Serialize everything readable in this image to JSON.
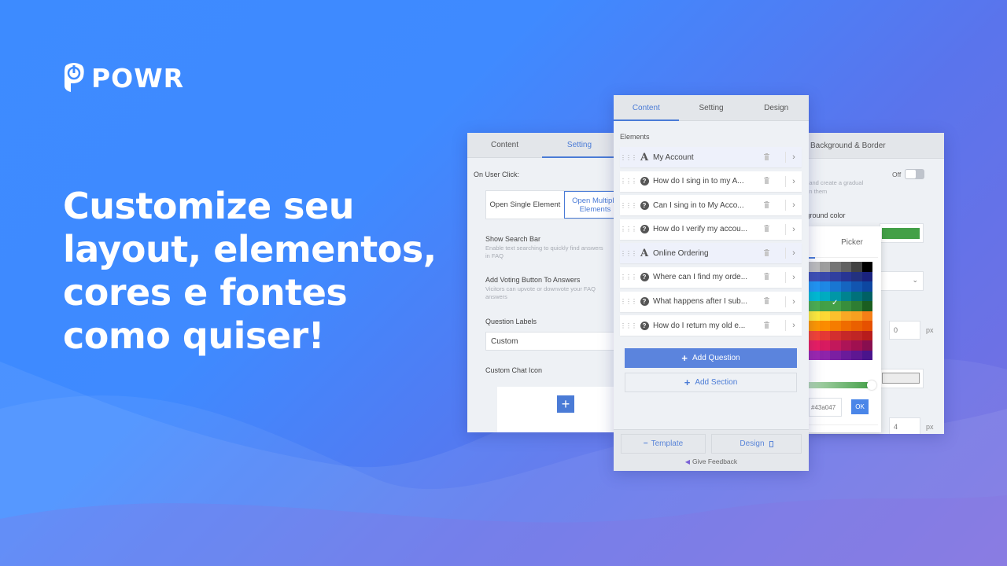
{
  "brand": {
    "name": "POWR"
  },
  "headline": {
    "lines": [
      "Customize seu",
      "layout, elementos,",
      "cores e fontes",
      "como quiser!"
    ]
  },
  "left_panel": {
    "tabs": [
      {
        "label": "Content",
        "active": false
      },
      {
        "label": "Setting",
        "active": true
      }
    ],
    "on_user_click_label": "On User Click:",
    "segmented": [
      {
        "label": "Open Single Element",
        "active": false
      },
      {
        "label": "Open Multiple Elements",
        "active": true
      }
    ],
    "show_search_bar": {
      "label": "Show Search Bar",
      "description": "Enable text searching to quickly find answers in FAQ"
    },
    "voting_button": {
      "label": "Add Voting Button To Answers",
      "description": "Vicitors can upvote or downvote your FAQ answers"
    },
    "question_labels": {
      "label": "Question Labels",
      "value": "Custom"
    },
    "custom_chat_icon": {
      "label": "Custom Chat Icon",
      "add_icon": "+"
    }
  },
  "center_panel": {
    "tabs": [
      {
        "label": "Content",
        "active": true
      },
      {
        "label": "Setting",
        "active": false
      },
      {
        "label": "Design",
        "active": false
      }
    ],
    "elements_label": "Elements",
    "elements": [
      {
        "type": "section",
        "label": "My Account"
      },
      {
        "type": "question",
        "label": "How do I sing in to my A..."
      },
      {
        "type": "question",
        "label": "Can I sing in to My Acco..."
      },
      {
        "type": "question",
        "label": "How do I verify my accou..."
      },
      {
        "type": "section",
        "label": "Online Ordering"
      },
      {
        "type": "question",
        "label": "Where can I find my orde..."
      },
      {
        "type": "question",
        "label": "What happens after I sub..."
      },
      {
        "type": "question",
        "label": "How do I return my old e..."
      }
    ],
    "add_question_label": "Add Question",
    "add_section_label": "Add Section",
    "footer": {
      "template_label": "Template",
      "design_label": "Design",
      "feedback_label": "Give Feedback"
    }
  },
  "right_panel": {
    "header": "Background & Border",
    "gradient_toggle": {
      "state_label": "Off",
      "on": false
    },
    "gradient_description": "rs and create a gradual een them",
    "background_color_label": "kground color",
    "background_color": "#43a047",
    "border_width_1": {
      "value": "0",
      "unit": "px"
    },
    "border_radius": {
      "value": "4",
      "unit": "px"
    }
  },
  "color_picker": {
    "tab_label": "Picker",
    "hex_value": "#43a047",
    "ok_label": "OK",
    "opacity": 1.0,
    "selected_row": 4,
    "selected_col": 2,
    "swatches": [
      [
        "#bdbdbd",
        "#9e9e9e",
        "#757575",
        "#616161",
        "#424242",
        "#000000"
      ],
      [
        "#3f51b5",
        "#3949ab",
        "#303f9f",
        "#283593",
        "#233180",
        "#1a237e"
      ],
      [
        "#2196f3",
        "#1e88e5",
        "#1976d2",
        "#1565c0",
        "#1255b0",
        "#0d47a1"
      ],
      [
        "#00bcd4",
        "#00acc1",
        "#0097a7",
        "#00838f",
        "#00717a",
        "#006064"
      ],
      [
        "#4caf50",
        "#43a047",
        "#43a047",
        "#388e3c",
        "#2e7d32",
        "#1b5e20"
      ],
      [
        "#ffeb3b",
        "#fdd835",
        "#fbc02d",
        "#f9a825",
        "#f8a020",
        "#f57f17"
      ],
      [
        "#ff9800",
        "#fb8c00",
        "#f57c00",
        "#ef6c00",
        "#ea6000",
        "#e65100"
      ],
      [
        "#f44336",
        "#e53935",
        "#d32f2f",
        "#c62828",
        "#c02525",
        "#b71c1c"
      ],
      [
        "#e91e63",
        "#d81b60",
        "#c2185b",
        "#ad1457",
        "#a01050",
        "#880e4f"
      ],
      [
        "#9c27b0",
        "#8e24aa",
        "#7b1fa2",
        "#6a1b9a",
        "#5e1792",
        "#4a148c"
      ]
    ]
  },
  "icons": {
    "grip": "⋮⋮⋮",
    "trash": "🗑",
    "chevron": "›",
    "plus": "+",
    "minus": "−",
    "question": "?",
    "text_A": "A",
    "check": "✓",
    "select_chevron": "⌄"
  },
  "colors": {
    "accent": "#4a7bd6",
    "primary_button": "#5b84dd",
    "panel_bg": "#eef1f5",
    "bg_gradient_start": "#3d8bff",
    "bg_gradient_end": "#7a6fe0"
  }
}
